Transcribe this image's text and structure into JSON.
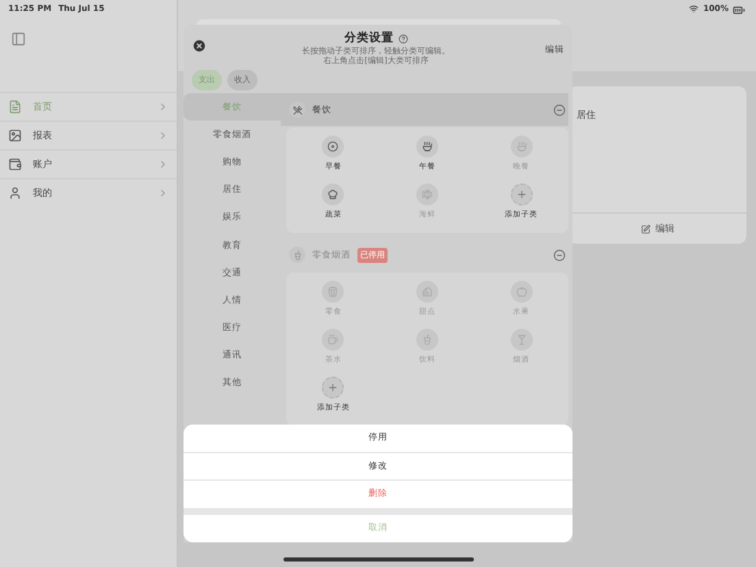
{
  "status_bar": {
    "time": "11:25 PM",
    "date": "Thu Jul 15",
    "battery": "100%"
  },
  "sidebar": {
    "items": [
      {
        "label": "首页",
        "selected": true
      },
      {
        "label": "报表",
        "selected": false
      },
      {
        "label": "账户",
        "selected": false
      },
      {
        "label": "我的",
        "selected": false
      }
    ]
  },
  "detail_card": {
    "title": "居住",
    "edit": "编辑"
  },
  "sheet": {
    "title": "分类设置",
    "hint_lines": [
      "长按拖动子类可排序，轻触分类可编辑。",
      "右上角点击[编辑]大类可排序"
    ],
    "edit": "编辑",
    "tabs": [
      {
        "label": "支出",
        "selected": true
      },
      {
        "label": "收入",
        "selected": false
      }
    ],
    "categories": [
      {
        "label": "餐饮",
        "selected": true
      },
      {
        "label": "零食烟酒",
        "selected": false
      },
      {
        "label": "购物",
        "selected": false
      },
      {
        "label": "居住",
        "selected": false
      },
      {
        "label": "娱乐",
        "selected": false
      },
      {
        "label": "教育",
        "selected": false
      },
      {
        "label": "交通",
        "selected": false
      },
      {
        "label": "人情",
        "selected": false
      },
      {
        "label": "医疗",
        "selected": false
      },
      {
        "label": "通讯",
        "selected": false
      },
      {
        "label": "其他",
        "selected": false
      }
    ],
    "groups": [
      {
        "name": "餐饮",
        "disabled": false,
        "add_label": "添加子类",
        "items": [
          {
            "label": "早餐",
            "disabled": false
          },
          {
            "label": "午餐",
            "disabled": false
          },
          {
            "label": "晚餐",
            "disabled": true
          },
          {
            "label": "蔬菜",
            "disabled": false
          },
          {
            "label": "海鲜",
            "disabled": true
          }
        ]
      },
      {
        "name": "零食烟酒",
        "disabled": true,
        "badge": "已停用",
        "add_label": "添加子类",
        "items": [
          {
            "label": "零食",
            "disabled": true
          },
          {
            "label": "甜点",
            "disabled": true
          },
          {
            "label": "水果",
            "disabled": true
          },
          {
            "label": "茶水",
            "disabled": true
          },
          {
            "label": "饮料",
            "disabled": true
          },
          {
            "label": "烟酒",
            "disabled": true
          }
        ]
      }
    ]
  },
  "action_sheet": {
    "actions": [
      {
        "label": "停用",
        "kind": "normal"
      },
      {
        "label": "修改",
        "kind": "normal"
      },
      {
        "label": "删除",
        "kind": "destructive"
      }
    ],
    "cancel": "取消"
  }
}
